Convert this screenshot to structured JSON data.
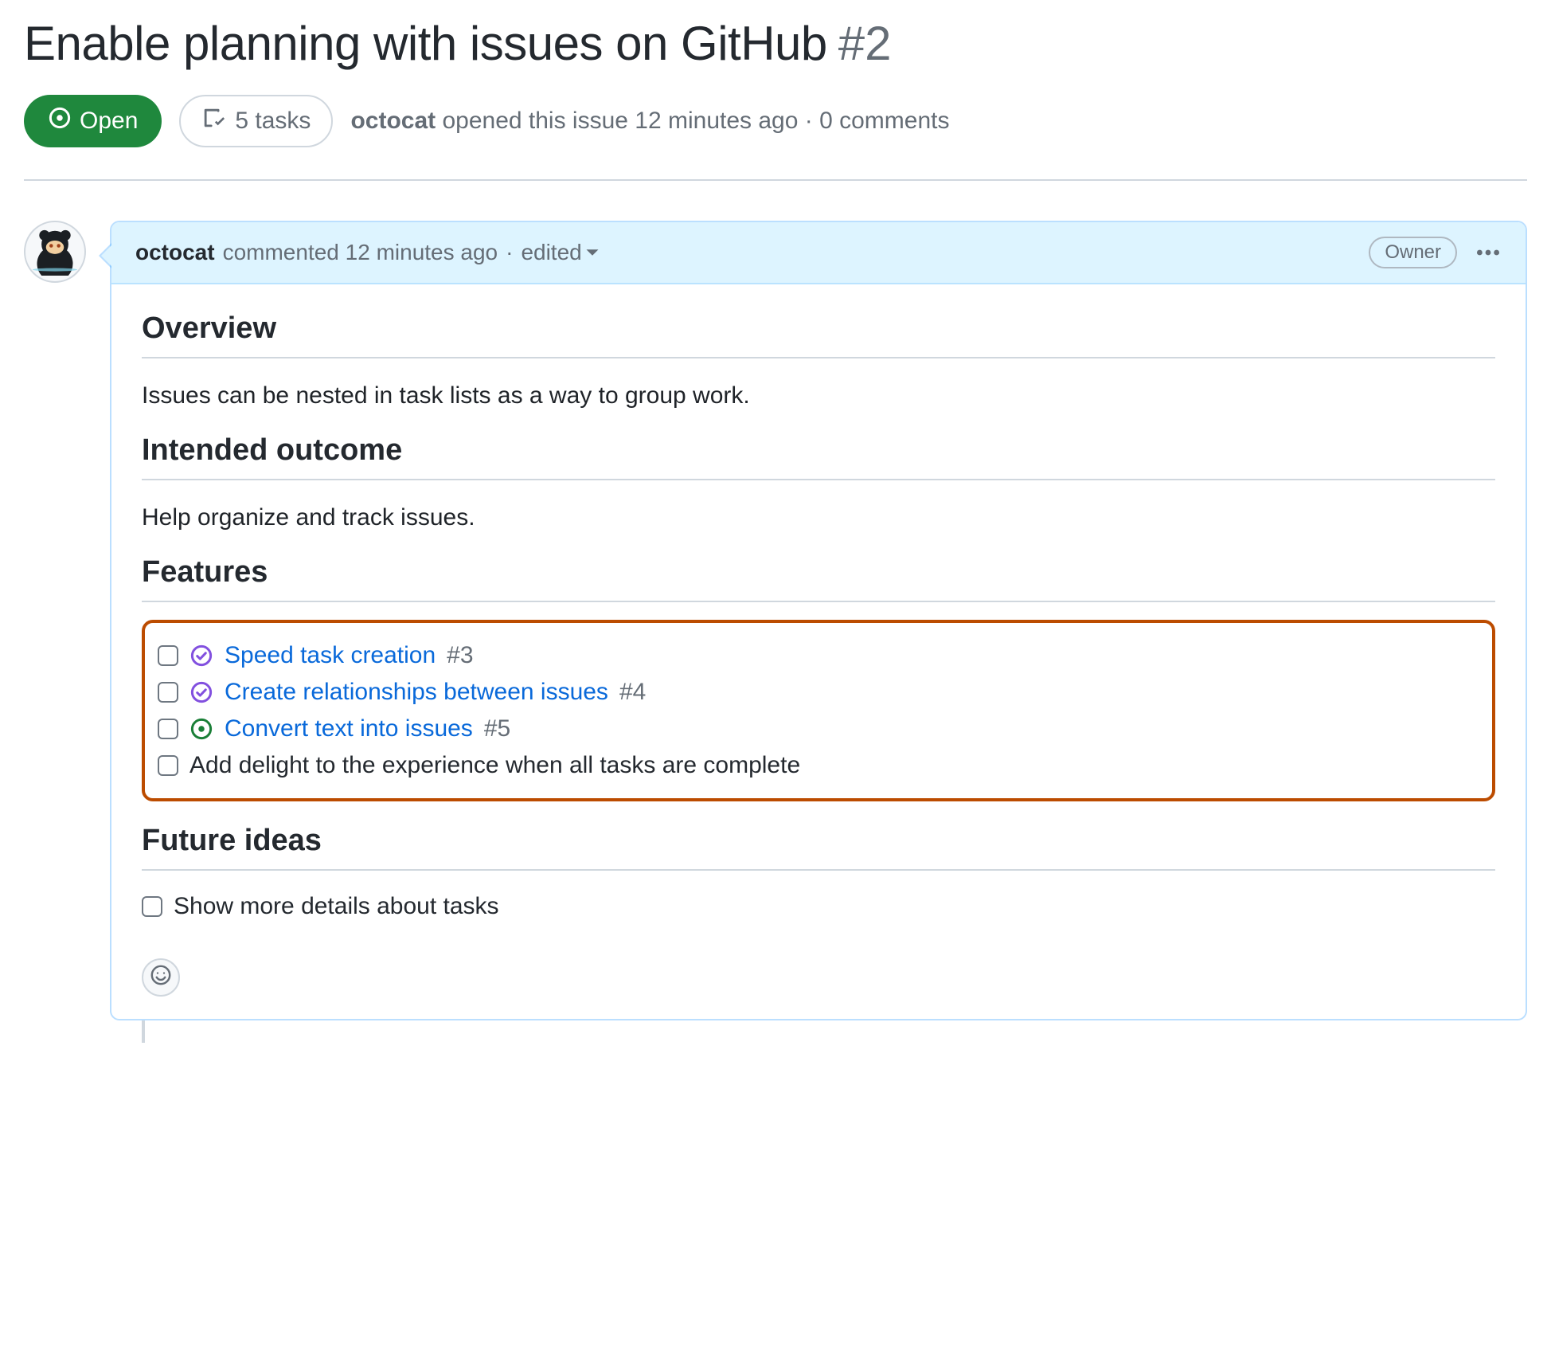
{
  "issue": {
    "title": "Enable planning with issues on GitHub",
    "number": "#2",
    "state": "Open",
    "tasks_label": "5 tasks",
    "meta_author": "octocat",
    "meta_opened": " opened this issue 12 minutes ago · 0 comments"
  },
  "comment": {
    "author": "octocat",
    "commented_text": " commented 12 minutes ago ",
    "sep": "·",
    "edited": " edited",
    "owner_badge": "Owner",
    "body": {
      "h_overview": "Overview",
      "p_overview": "Issues can be nested in task lists as a way to group work.",
      "h_intended": "Intended outcome",
      "p_intended": "Help organize and track issues.",
      "h_features": "Features",
      "features": [
        {
          "status": "closed",
          "text": "Speed task creation",
          "ref": "#3"
        },
        {
          "status": "closed",
          "text": "Create relationships between issues",
          "ref": "#4"
        },
        {
          "status": "open",
          "text": "Convert text into issues",
          "ref": "#5"
        },
        {
          "status": "plain",
          "text": "Add delight to the experience when all tasks are complete",
          "ref": ""
        }
      ],
      "h_future": "Future ideas",
      "future": [
        {
          "status": "plain",
          "text": "Show more details about tasks",
          "ref": ""
        }
      ]
    }
  }
}
